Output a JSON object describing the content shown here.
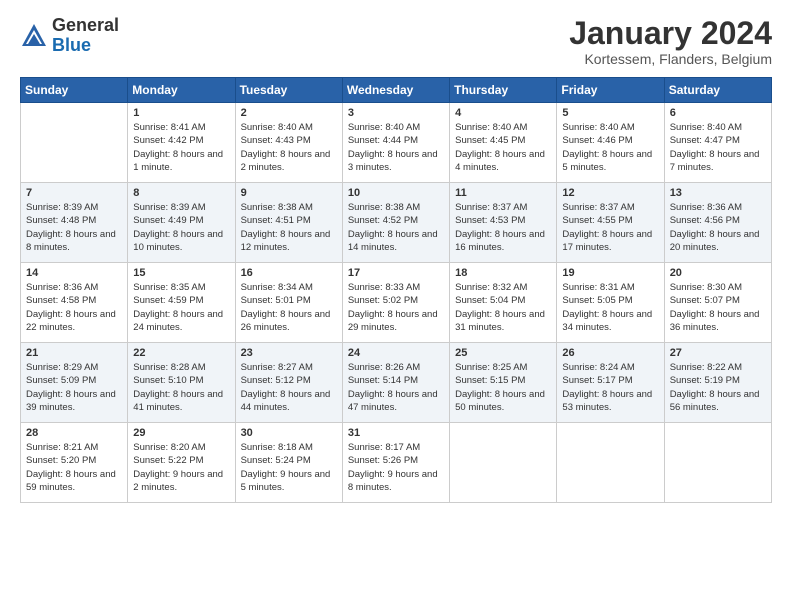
{
  "header": {
    "logo_general": "General",
    "logo_blue": "Blue",
    "month_title": "January 2024",
    "subtitle": "Kortessem, Flanders, Belgium"
  },
  "days_of_week": [
    "Sunday",
    "Monday",
    "Tuesday",
    "Wednesday",
    "Thursday",
    "Friday",
    "Saturday"
  ],
  "weeks": [
    [
      {
        "day": "",
        "sunrise": "",
        "sunset": "",
        "daylight": ""
      },
      {
        "day": "1",
        "sunrise": "Sunrise: 8:41 AM",
        "sunset": "Sunset: 4:42 PM",
        "daylight": "Daylight: 8 hours and 1 minute."
      },
      {
        "day": "2",
        "sunrise": "Sunrise: 8:40 AM",
        "sunset": "Sunset: 4:43 PM",
        "daylight": "Daylight: 8 hours and 2 minutes."
      },
      {
        "day": "3",
        "sunrise": "Sunrise: 8:40 AM",
        "sunset": "Sunset: 4:44 PM",
        "daylight": "Daylight: 8 hours and 3 minutes."
      },
      {
        "day": "4",
        "sunrise": "Sunrise: 8:40 AM",
        "sunset": "Sunset: 4:45 PM",
        "daylight": "Daylight: 8 hours and 4 minutes."
      },
      {
        "day": "5",
        "sunrise": "Sunrise: 8:40 AM",
        "sunset": "Sunset: 4:46 PM",
        "daylight": "Daylight: 8 hours and 5 minutes."
      },
      {
        "day": "6",
        "sunrise": "Sunrise: 8:40 AM",
        "sunset": "Sunset: 4:47 PM",
        "daylight": "Daylight: 8 hours and 7 minutes."
      }
    ],
    [
      {
        "day": "7",
        "sunrise": "Sunrise: 8:39 AM",
        "sunset": "Sunset: 4:48 PM",
        "daylight": "Daylight: 8 hours and 8 minutes."
      },
      {
        "day": "8",
        "sunrise": "Sunrise: 8:39 AM",
        "sunset": "Sunset: 4:49 PM",
        "daylight": "Daylight: 8 hours and 10 minutes."
      },
      {
        "day": "9",
        "sunrise": "Sunrise: 8:38 AM",
        "sunset": "Sunset: 4:51 PM",
        "daylight": "Daylight: 8 hours and 12 minutes."
      },
      {
        "day": "10",
        "sunrise": "Sunrise: 8:38 AM",
        "sunset": "Sunset: 4:52 PM",
        "daylight": "Daylight: 8 hours and 14 minutes."
      },
      {
        "day": "11",
        "sunrise": "Sunrise: 8:37 AM",
        "sunset": "Sunset: 4:53 PM",
        "daylight": "Daylight: 8 hours and 16 minutes."
      },
      {
        "day": "12",
        "sunrise": "Sunrise: 8:37 AM",
        "sunset": "Sunset: 4:55 PM",
        "daylight": "Daylight: 8 hours and 17 minutes."
      },
      {
        "day": "13",
        "sunrise": "Sunrise: 8:36 AM",
        "sunset": "Sunset: 4:56 PM",
        "daylight": "Daylight: 8 hours and 20 minutes."
      }
    ],
    [
      {
        "day": "14",
        "sunrise": "Sunrise: 8:36 AM",
        "sunset": "Sunset: 4:58 PM",
        "daylight": "Daylight: 8 hours and 22 minutes."
      },
      {
        "day": "15",
        "sunrise": "Sunrise: 8:35 AM",
        "sunset": "Sunset: 4:59 PM",
        "daylight": "Daylight: 8 hours and 24 minutes."
      },
      {
        "day": "16",
        "sunrise": "Sunrise: 8:34 AM",
        "sunset": "Sunset: 5:01 PM",
        "daylight": "Daylight: 8 hours and 26 minutes."
      },
      {
        "day": "17",
        "sunrise": "Sunrise: 8:33 AM",
        "sunset": "Sunset: 5:02 PM",
        "daylight": "Daylight: 8 hours and 29 minutes."
      },
      {
        "day": "18",
        "sunrise": "Sunrise: 8:32 AM",
        "sunset": "Sunset: 5:04 PM",
        "daylight": "Daylight: 8 hours and 31 minutes."
      },
      {
        "day": "19",
        "sunrise": "Sunrise: 8:31 AM",
        "sunset": "Sunset: 5:05 PM",
        "daylight": "Daylight: 8 hours and 34 minutes."
      },
      {
        "day": "20",
        "sunrise": "Sunrise: 8:30 AM",
        "sunset": "Sunset: 5:07 PM",
        "daylight": "Daylight: 8 hours and 36 minutes."
      }
    ],
    [
      {
        "day": "21",
        "sunrise": "Sunrise: 8:29 AM",
        "sunset": "Sunset: 5:09 PM",
        "daylight": "Daylight: 8 hours and 39 minutes."
      },
      {
        "day": "22",
        "sunrise": "Sunrise: 8:28 AM",
        "sunset": "Sunset: 5:10 PM",
        "daylight": "Daylight: 8 hours and 41 minutes."
      },
      {
        "day": "23",
        "sunrise": "Sunrise: 8:27 AM",
        "sunset": "Sunset: 5:12 PM",
        "daylight": "Daylight: 8 hours and 44 minutes."
      },
      {
        "day": "24",
        "sunrise": "Sunrise: 8:26 AM",
        "sunset": "Sunset: 5:14 PM",
        "daylight": "Daylight: 8 hours and 47 minutes."
      },
      {
        "day": "25",
        "sunrise": "Sunrise: 8:25 AM",
        "sunset": "Sunset: 5:15 PM",
        "daylight": "Daylight: 8 hours and 50 minutes."
      },
      {
        "day": "26",
        "sunrise": "Sunrise: 8:24 AM",
        "sunset": "Sunset: 5:17 PM",
        "daylight": "Daylight: 8 hours and 53 minutes."
      },
      {
        "day": "27",
        "sunrise": "Sunrise: 8:22 AM",
        "sunset": "Sunset: 5:19 PM",
        "daylight": "Daylight: 8 hours and 56 minutes."
      }
    ],
    [
      {
        "day": "28",
        "sunrise": "Sunrise: 8:21 AM",
        "sunset": "Sunset: 5:20 PM",
        "daylight": "Daylight: 8 hours and 59 minutes."
      },
      {
        "day": "29",
        "sunrise": "Sunrise: 8:20 AM",
        "sunset": "Sunset: 5:22 PM",
        "daylight": "Daylight: 9 hours and 2 minutes."
      },
      {
        "day": "30",
        "sunrise": "Sunrise: 8:18 AM",
        "sunset": "Sunset: 5:24 PM",
        "daylight": "Daylight: 9 hours and 5 minutes."
      },
      {
        "day": "31",
        "sunrise": "Sunrise: 8:17 AM",
        "sunset": "Sunset: 5:26 PM",
        "daylight": "Daylight: 9 hours and 8 minutes."
      },
      {
        "day": "",
        "sunrise": "",
        "sunset": "",
        "daylight": ""
      },
      {
        "day": "",
        "sunrise": "",
        "sunset": "",
        "daylight": ""
      },
      {
        "day": "",
        "sunrise": "",
        "sunset": "",
        "daylight": ""
      }
    ]
  ]
}
